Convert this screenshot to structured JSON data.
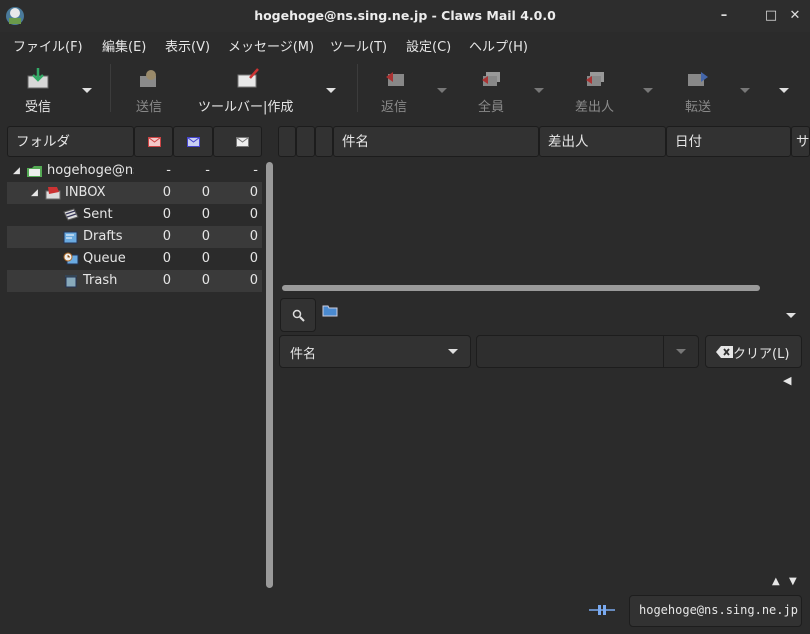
{
  "window": {
    "title": "hogehoge@ns.sing.ne.jp - Claws Mail 4.0.0",
    "minimize": "–",
    "maximize": "□",
    "close": "✕"
  },
  "menubar": [
    "ファイル(F)",
    "編集(E)",
    "表示(V)",
    "メッセージ(M)",
    "ツール(T)",
    "設定(C)",
    "ヘルプ(H)"
  ],
  "toolbar": {
    "receive": "受信",
    "send": "送信",
    "compose": "ツールバー|作成",
    "reply": "返信",
    "reply_all": "全員",
    "reply_sender": "差出人",
    "forward": "転送"
  },
  "folder_columns": {
    "folder": "フォルダ"
  },
  "folders": [
    {
      "name": "hogehoge@ns",
      "new": "-",
      "unread": "-",
      "total": "-"
    },
    {
      "name": "INBOX",
      "new": "0",
      "unread": "0",
      "total": "0"
    },
    {
      "name": "Sent",
      "new": "0",
      "unread": "0",
      "total": "0"
    },
    {
      "name": "Drafts",
      "new": "0",
      "unread": "0",
      "total": "0"
    },
    {
      "name": "Queue",
      "new": "0",
      "unread": "0",
      "total": "0"
    },
    {
      "name": "Trash",
      "new": "0",
      "unread": "0",
      "total": "0"
    }
  ],
  "message_columns": {
    "subject": "件名",
    "from": "差出人",
    "date": "日付",
    "size": "サ"
  },
  "search": {
    "field": "件名",
    "value": "",
    "clear": "クリア(L)"
  },
  "statusbar": {
    "account": "hogehoge@ns.sing.ne.jp"
  },
  "colors": {
    "background": "#2b2b2b",
    "header": "#323232",
    "alt_row": "#3a3a3a"
  }
}
